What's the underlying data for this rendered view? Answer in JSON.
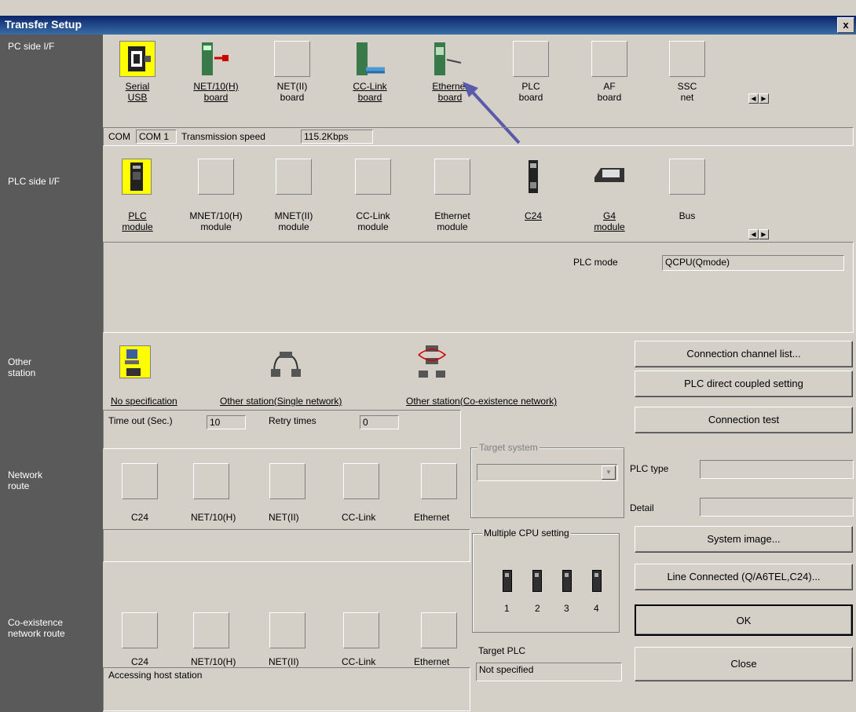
{
  "window": {
    "title": "Transfer Setup",
    "close_glyph": "x"
  },
  "left_labels": {
    "pc_side": "PC side I/F",
    "plc_side": "PLC side I/F",
    "other_station_1": "Other",
    "other_station_2": "station",
    "network_route_1": "Network",
    "network_route_2": "route",
    "coexist_1": "Co-existence",
    "coexist_2": "network route"
  },
  "pc_side": {
    "items": [
      {
        "l1": "Serial",
        "l2": "USB"
      },
      {
        "l1": "NET/10(H)",
        "l2": "board"
      },
      {
        "l1": "NET(II)",
        "l2": "board"
      },
      {
        "l1": "CC-Link",
        "l2": "board"
      },
      {
        "l1": "Ethernet",
        "l2": "board"
      },
      {
        "l1": "PLC",
        "l2": "board"
      },
      {
        "l1": "AF",
        "l2": "board"
      },
      {
        "l1": "SSC",
        "l2": "net"
      }
    ],
    "com_label": "COM",
    "com_value": "COM 1",
    "speed_label": "Transmission speed",
    "speed_value": "115.2Kbps"
  },
  "plc_side": {
    "items": [
      {
        "l1": "PLC",
        "l2": "module"
      },
      {
        "l1": "MNET/10(H)",
        "l2": "module"
      },
      {
        "l1": "MNET(II)",
        "l2": "module"
      },
      {
        "l1": "CC-Link",
        "l2": "module"
      },
      {
        "l1": "Ethernet",
        "l2": "module"
      },
      {
        "l1": "C24",
        "l2": ""
      },
      {
        "l1": "G4",
        "l2": "module"
      },
      {
        "l1": "Bus",
        "l2": ""
      }
    ],
    "mode_label": "PLC mode",
    "mode_value": "QCPU(Qmode)"
  },
  "other_station": {
    "no_spec": "No specification",
    "single": "Other station(Single network)",
    "coexist": "Other station(Co-existence network)",
    "timeout_label": "Time out (Sec.)",
    "timeout_value": "10",
    "retry_label": "Retry times",
    "retry_value": "0"
  },
  "network_route": [
    "C24",
    "NET/10(H)",
    "NET(II)",
    "CC-Link",
    "Ethernet"
  ],
  "coexist_route": [
    "C24",
    "NET/10(H)",
    "NET(II)",
    "CC-Link",
    "Ethernet"
  ],
  "accessing": "Accessing host station",
  "target_system": {
    "label": "Target system",
    "value": ""
  },
  "multi_cpu": {
    "label": "Multiple CPU setting",
    "nums": [
      "1",
      "2",
      "3",
      "4"
    ]
  },
  "target_plc": {
    "label": "Target PLC",
    "value": "Not specified"
  },
  "buttons": {
    "conn_channel": "Connection  channel  list...",
    "direct": "PLC direct coupled setting",
    "conn_test": "Connection test",
    "system_image": "System   image...",
    "line_connected": "Line Connected (Q/A6TEL,C24)...",
    "ok": "OK",
    "close": "Close"
  },
  "plc_type": {
    "label": "PLC type",
    "value": ""
  },
  "detail": {
    "label": "Detail",
    "value": ""
  }
}
